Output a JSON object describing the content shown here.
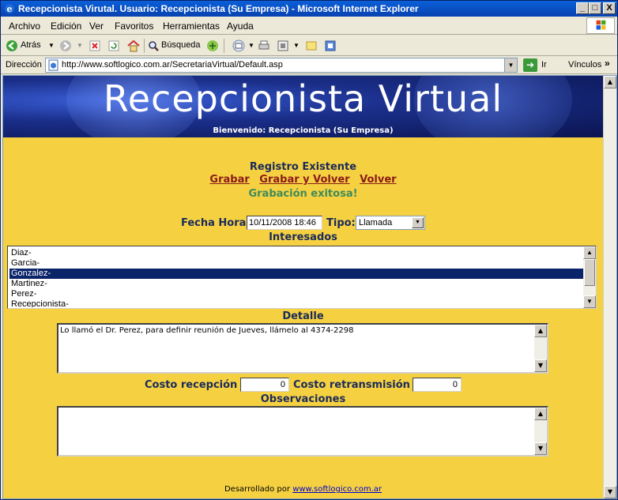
{
  "window": {
    "title": "Recepcionista Virutal. Usuario: Recepcionista (Su Empresa) - Microsoft Internet Explorer",
    "minimize": "_",
    "maximize": "□",
    "close": "X"
  },
  "menubar": {
    "items": [
      "Archivo",
      "Edición",
      "Ver",
      "Favoritos",
      "Herramientas",
      "Ayuda"
    ]
  },
  "toolbar": {
    "back_label": "Atrás",
    "search_label": "Búsqueda"
  },
  "address": {
    "label": "Dirección",
    "url": "http://www.softlogico.com.ar/SecretariaVirtual/Default.asp",
    "go_label": "Ir",
    "links_label": "Vínculos"
  },
  "banner": {
    "title": "Recepcionista Virtual",
    "welcome": "Bienvenido: Recepcionista (Su Empresa)"
  },
  "form": {
    "status_heading": "Registro Existente",
    "actions": [
      "Grabar",
      "Grabar y Volver",
      "Volver"
    ],
    "success_message": "Grabación exitosa!",
    "datetime_label": "Fecha Hora",
    "datetime_value": "10/11/2008 18:46",
    "type_label": "Tipo:",
    "type_value": "Llamada",
    "interested_label": "Interesados",
    "interested_options": [
      "Diaz-",
      "Garcia-",
      "Gonzalez-",
      "Martinez-",
      "Perez-",
      "Recepcionista-"
    ],
    "interested_selected": "Gonzalez-",
    "detail_label": "Detalle",
    "detail_value": "Lo llamó el Dr. Perez, para definir reunión de Jueves, llámelo al 4374-2298",
    "cost_reception_label": "Costo recepción",
    "cost_reception_value": "0",
    "cost_retransmission_label": "Costo retransmisión",
    "cost_retransmission_value": "0",
    "observations_label": "Observaciones",
    "observations_value": ""
  },
  "footer": {
    "prefix": "Desarrollado por",
    "link": "www.softlogico.com.ar"
  },
  "colors": {
    "page_background": "#f5d142",
    "heading": "#1b2a5a",
    "action_link": "#8b1a1a",
    "success": "#3f8a5a",
    "selection": "#0a246a"
  }
}
